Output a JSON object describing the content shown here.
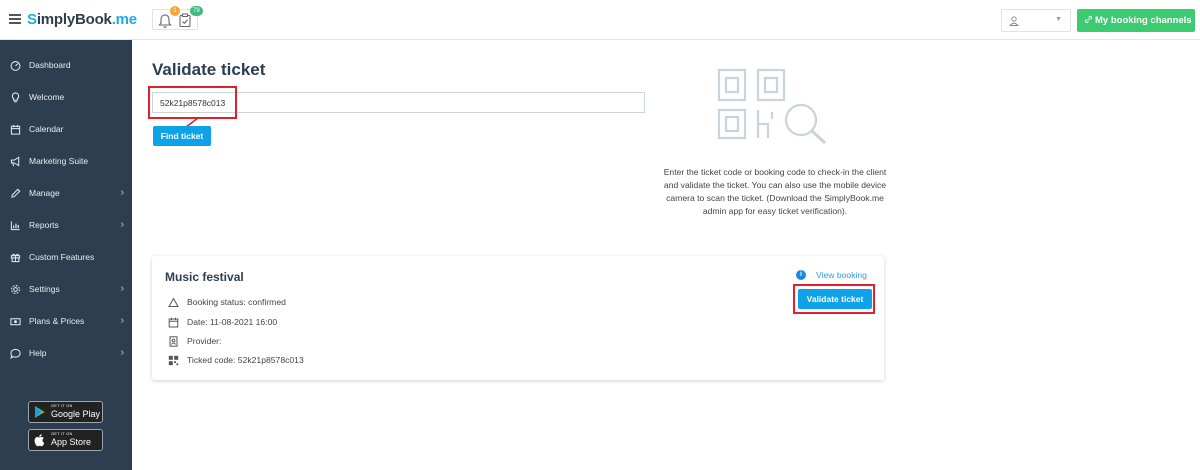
{
  "app": {
    "logo_text": "implyBook",
    "logo_s": "S",
    "logo_suffix": ".me"
  },
  "topbar": {
    "notifications_count": "1",
    "tasks_count": "79",
    "channels_label": "My booking channels",
    "bell_icon": "bell-icon",
    "tasks_icon": "clipboard-check-icon",
    "user_icon": "user-icon",
    "colors": {
      "channels_bg": "#3ccb71",
      "badge_orange": "#f3a73b",
      "badge_green": "#42b883"
    }
  },
  "sidebar": {
    "items": [
      {
        "label": "Dashboard",
        "icon": "dashboard-icon",
        "has_submenu": false
      },
      {
        "label": "Welcome",
        "icon": "lightbulb-icon",
        "has_submenu": false
      },
      {
        "label": "Calendar",
        "icon": "calendar-icon",
        "has_submenu": false
      },
      {
        "label": "Marketing Suite",
        "icon": "megaphone-icon",
        "has_submenu": false
      },
      {
        "label": "Manage",
        "icon": "pencil-icon",
        "has_submenu": true
      },
      {
        "label": "Reports",
        "icon": "bar-chart-icon",
        "has_submenu": true
      },
      {
        "label": "Custom Features",
        "icon": "gift-icon",
        "has_submenu": false
      },
      {
        "label": "Settings",
        "icon": "gear-icon",
        "has_submenu": true
      },
      {
        "label": "Plans & Prices",
        "icon": "money-icon",
        "has_submenu": true
      },
      {
        "label": "Help",
        "icon": "chat-icon",
        "has_submenu": true
      }
    ],
    "google_play": {
      "small": "GET IT ON",
      "big": "Google Play"
    },
    "app_store": {
      "small": "GET IT ON",
      "big": "App Store"
    },
    "colors": {
      "background": "#2c3e50"
    }
  },
  "main": {
    "title": "Validate ticket",
    "ticket_input_value": "52k21p8578c013",
    "find_button": "Find ticket",
    "help_text": "Enter the ticket code or booking code to check-in the client and validate the ticket. You can also use the mobile device camera to scan the ticket. (Download the SimplyBook.me admin app for easy ticket verification).",
    "accent_color": "#0ea2e8",
    "highlight_color": "#e0202a"
  },
  "result_card": {
    "event_name": "Music festival",
    "view_booking_label": "View booking",
    "validate_button": "Validate ticket",
    "rows": [
      {
        "icon": "triangle-icon",
        "text": "Booking status: confirmed"
      },
      {
        "icon": "calendar-icon",
        "text": "Date: 11-08-2021 16:00"
      },
      {
        "icon": "id-badge-icon",
        "text": "Provider:"
      },
      {
        "icon": "qr-code-icon",
        "text": "Ticked code: 52k21p8578c013"
      }
    ]
  }
}
